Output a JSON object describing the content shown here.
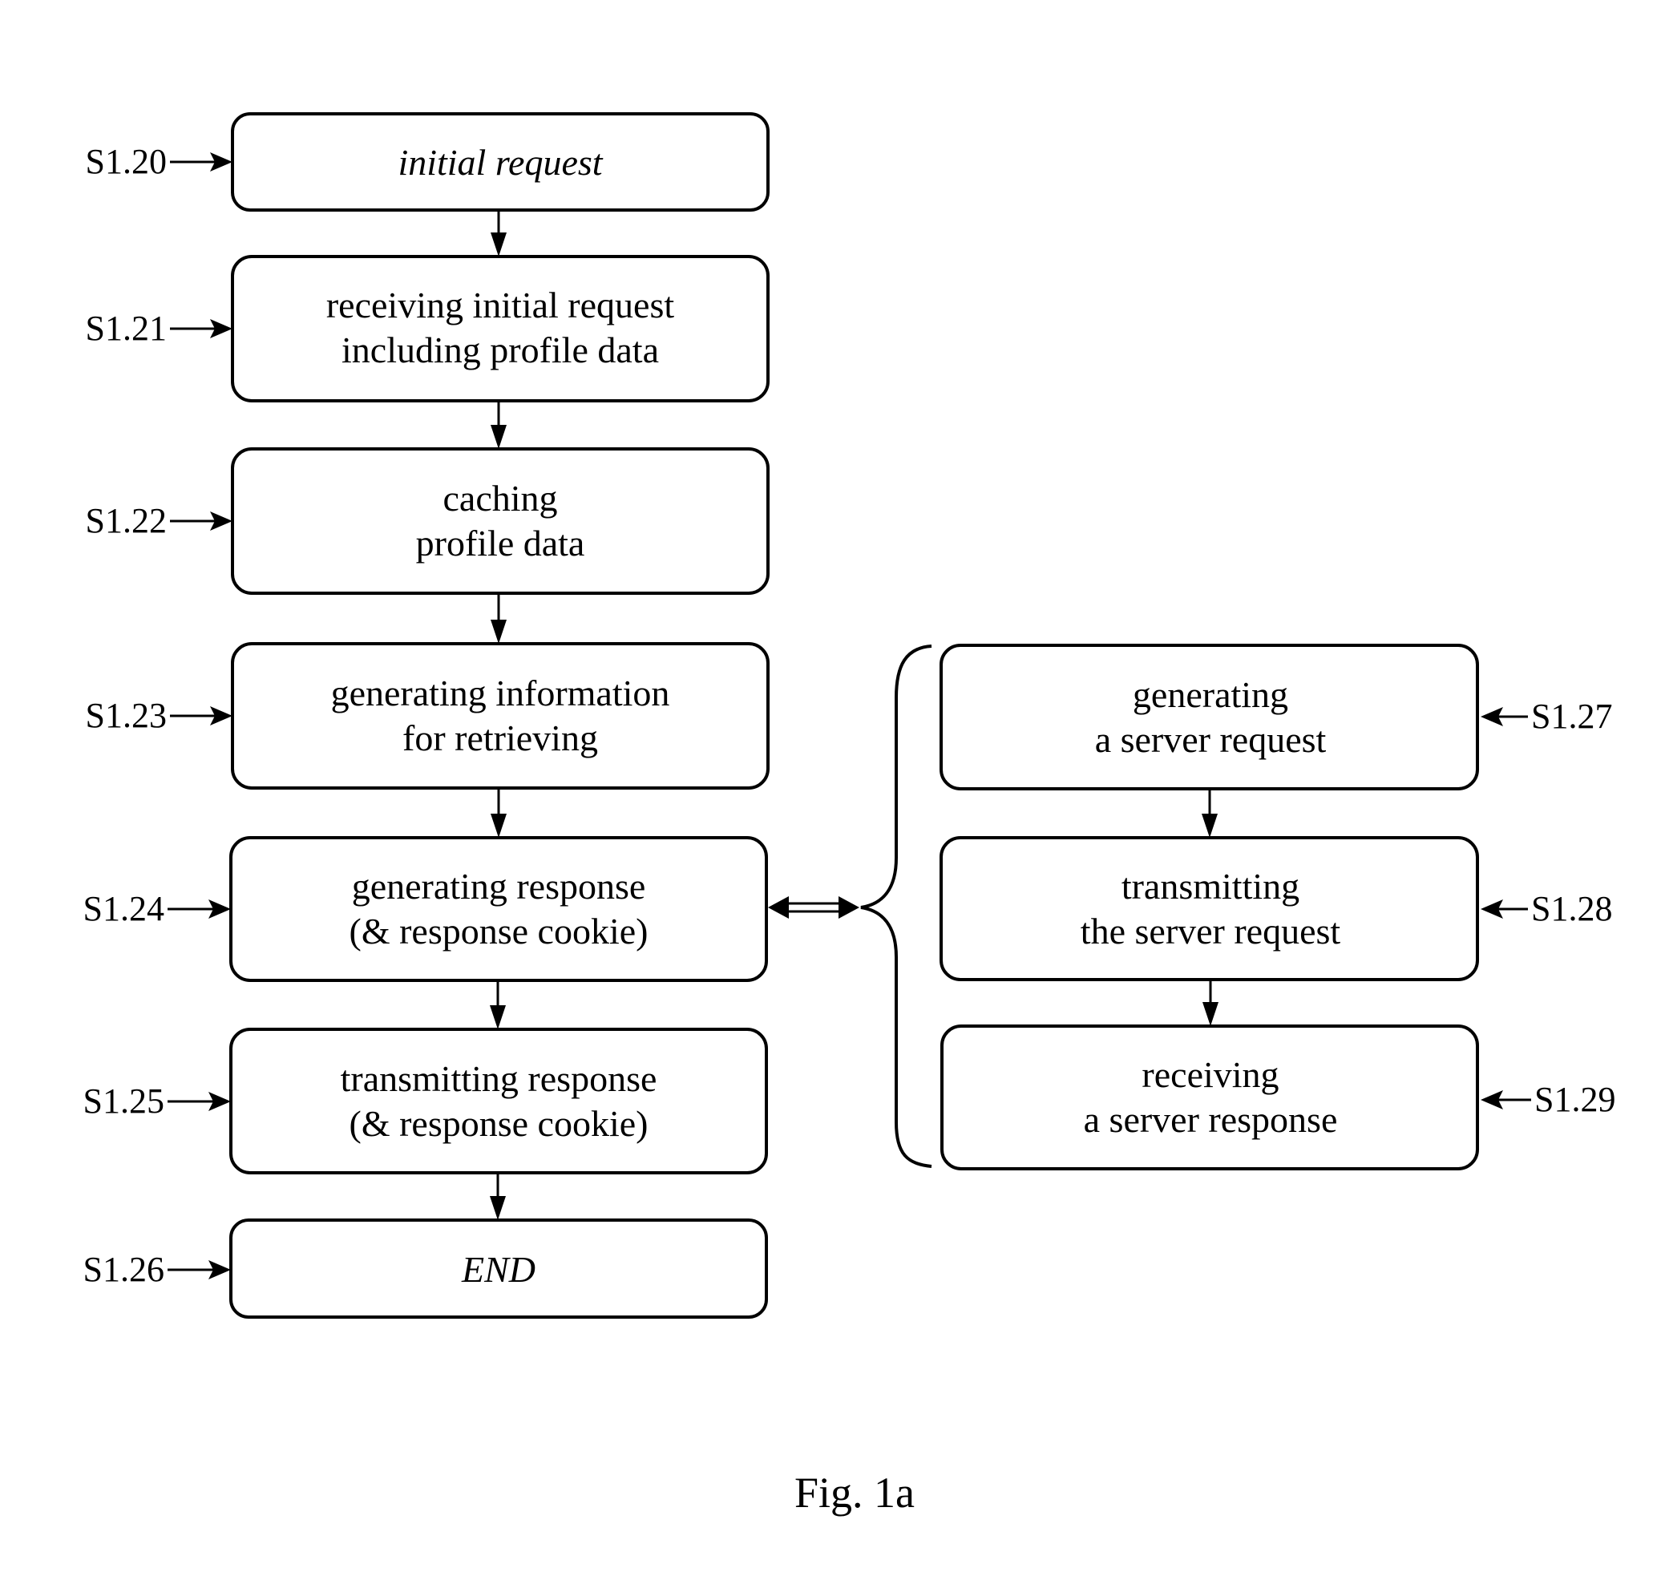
{
  "figure": {
    "caption": "Fig. 1a",
    "colors": {
      "stroke": "#000000",
      "background": "#ffffff"
    }
  },
  "main_flow": [
    {
      "id": "S1.20",
      "lines": [
        "initial request"
      ],
      "italic": true
    },
    {
      "id": "S1.21",
      "lines": [
        "receiving initial request",
        "including profile data"
      ]
    },
    {
      "id": "S1.22",
      "lines": [
        "caching",
        "profile data"
      ]
    },
    {
      "id": "S1.23",
      "lines": [
        "generating information",
        "for retrieving"
      ]
    },
    {
      "id": "S1.24",
      "lines": [
        "generating response",
        "(& response cookie)"
      ]
    },
    {
      "id": "S1.25",
      "lines": [
        "transmitting response",
        "(& response cookie)"
      ]
    },
    {
      "id": "S1.26",
      "lines": [
        "END"
      ],
      "italic": true
    }
  ],
  "sub_flow": [
    {
      "id": "S1.27",
      "lines": [
        "generating",
        "a server request"
      ]
    },
    {
      "id": "S1.28",
      "lines": [
        "transmitting",
        "the server request"
      ]
    },
    {
      "id": "S1.29",
      "lines": [
        "receiving",
        "a server response"
      ]
    }
  ],
  "links": {
    "bidirectional": {
      "from": "S1.24",
      "to": "sub_flow_group"
    }
  }
}
